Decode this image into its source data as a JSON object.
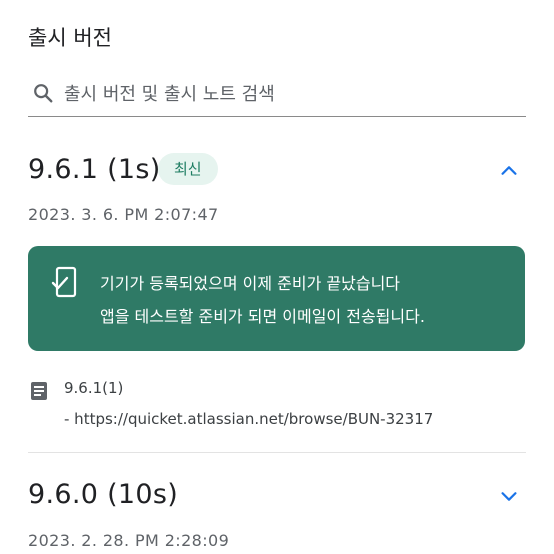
{
  "page": {
    "title": "출시 버전"
  },
  "search": {
    "placeholder": "출시 버전 및 출시 노트 검색",
    "value": ""
  },
  "releases": [
    {
      "version": "9.6.1 (1s)",
      "badge": "최신",
      "date": "2023. 3. 6. PM 2:07:47",
      "expanded": true,
      "notice": {
        "line1": "기기가 등록되었으며 이제 준비가 끝났습니다",
        "line2": "앱을 테스트할 준비가 되면 이메일이 전송됩니다."
      },
      "notes": {
        "title": "9.6.1(1)",
        "link": "- https://quicket.atlassian.net/browse/BUN-32317"
      }
    },
    {
      "version": "9.6.0 (10s)",
      "date": "2023. 2. 28. PM 2:28:09",
      "expanded": false
    }
  ],
  "colors": {
    "accent": "#2f7a66",
    "badge_bg": "#e6f4ef",
    "badge_text": "#1e7d62",
    "chevron": "#1a73e8"
  },
  "icons": [
    "search-icon",
    "chevron-up-icon",
    "phone-check-icon",
    "document-icon",
    "chevron-down-icon"
  ]
}
